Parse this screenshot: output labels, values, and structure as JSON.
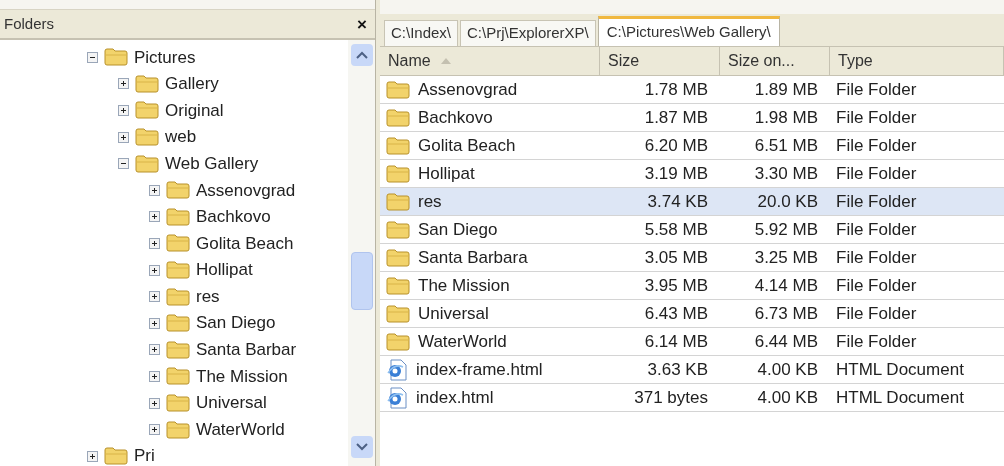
{
  "folders_pane": {
    "title": "Folders",
    "close": "×",
    "tree": [
      {
        "label": "Pictures",
        "expanded": true,
        "children": [
          {
            "label": "Gallery",
            "expanded": false
          },
          {
            "label": "Original",
            "expanded": false
          },
          {
            "label": "web",
            "expanded": false
          },
          {
            "label": "Web Gallery",
            "expanded": true,
            "children": [
              {
                "label": "Assenovgrad",
                "expanded": false
              },
              {
                "label": "Bachkovo",
                "expanded": false
              },
              {
                "label": "Golita Beach",
                "expanded": false
              },
              {
                "label": "Hollipat",
                "expanded": false
              },
              {
                "label": "res",
                "expanded": false
              },
              {
                "label": "San Diego",
                "expanded": false
              },
              {
                "label": "Santa Barbar",
                "expanded": false
              },
              {
                "label": "The Mission",
                "expanded": false
              },
              {
                "label": "Universal",
                "expanded": false
              },
              {
                "label": "WaterWorld",
                "expanded": false
              }
            ]
          }
        ]
      },
      {
        "label": "Pri",
        "expanded": false
      }
    ]
  },
  "tabs": [
    {
      "label": "C:\\Index\\",
      "selected": false
    },
    {
      "label": "C:\\Prj\\ExplorerXP\\",
      "selected": false
    },
    {
      "label": "C:\\Pictures\\Web Gallery\\",
      "selected": true
    }
  ],
  "table": {
    "columns": [
      "Name",
      "Size",
      "Size on...",
      "Type"
    ],
    "rows": [
      {
        "kind": "folder",
        "name": "Assenovgrad",
        "size": "1.78 MB",
        "size_on_disk": "1.89 MB",
        "type": "File Folder",
        "selected": false
      },
      {
        "kind": "folder",
        "name": "Bachkovo",
        "size": "1.87 MB",
        "size_on_disk": "1.98 MB",
        "type": "File Folder",
        "selected": false
      },
      {
        "kind": "folder",
        "name": "Golita Beach",
        "size": "6.20 MB",
        "size_on_disk": "6.51 MB",
        "type": "File Folder",
        "selected": false
      },
      {
        "kind": "folder",
        "name": "Hollipat",
        "size": "3.19 MB",
        "size_on_disk": "3.30 MB",
        "type": "File Folder",
        "selected": false
      },
      {
        "kind": "folder",
        "name": "res",
        "size": "3.74 KB",
        "size_on_disk": "20.0 KB",
        "type": "File Folder",
        "selected": true
      },
      {
        "kind": "folder",
        "name": "San Diego",
        "size": "5.58 MB",
        "size_on_disk": "5.92 MB",
        "type": "File Folder",
        "selected": false
      },
      {
        "kind": "folder",
        "name": "Santa Barbara",
        "size": "3.05 MB",
        "size_on_disk": "3.25 MB",
        "type": "File Folder",
        "selected": false
      },
      {
        "kind": "folder",
        "name": "The Mission",
        "size": "3.95 MB",
        "size_on_disk": "4.14 MB",
        "type": "File Folder",
        "selected": false
      },
      {
        "kind": "folder",
        "name": "Universal",
        "size": "6.43 MB",
        "size_on_disk": "6.73 MB",
        "type": "File Folder",
        "selected": false
      },
      {
        "kind": "folder",
        "name": "WaterWorld",
        "size": "6.14 MB",
        "size_on_disk": "6.44 MB",
        "type": "File Folder",
        "selected": false
      },
      {
        "kind": "html",
        "name": "index-frame.html",
        "size": "3.63 KB",
        "size_on_disk": "4.00 KB",
        "type": "HTML Document",
        "selected": false
      },
      {
        "kind": "html",
        "name": "index.html",
        "size": "371 bytes",
        "size_on_disk": "4.00 KB",
        "type": "HTML Document",
        "selected": false
      }
    ]
  }
}
